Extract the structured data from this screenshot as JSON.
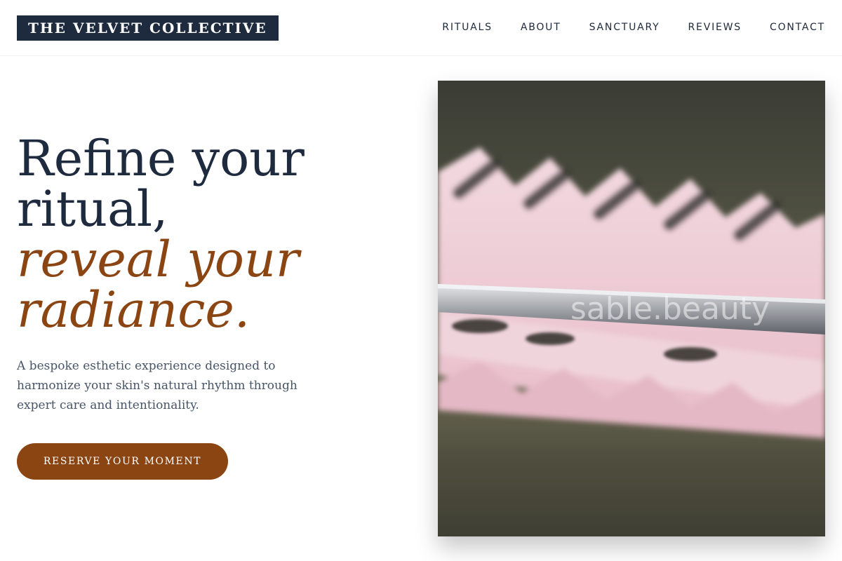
{
  "brand": {
    "name": "THE VELVET COLLECTIVE"
  },
  "nav": {
    "items": [
      {
        "label": "RITUALS"
      },
      {
        "label": "ABOUT"
      },
      {
        "label": "SANCTUARY"
      },
      {
        "label": "REVIEWS"
      },
      {
        "label": "CONTACT"
      }
    ]
  },
  "hero": {
    "headline_line1": "Refine your",
    "headline_line2": "ritual,",
    "headline_accent_line1": "reveal your",
    "headline_accent_line2": "radiance.",
    "description": "A bespoke esthetic experience designed to harmonize your skin's natural rhythm through expert care and intentionality.",
    "cta_label": "RESERVE YOUR MOMENT",
    "image_watermark": "sable.beauty"
  },
  "colors": {
    "navy": "#1e2a3e",
    "accent": "#8b4513",
    "body_text": "#475569"
  }
}
